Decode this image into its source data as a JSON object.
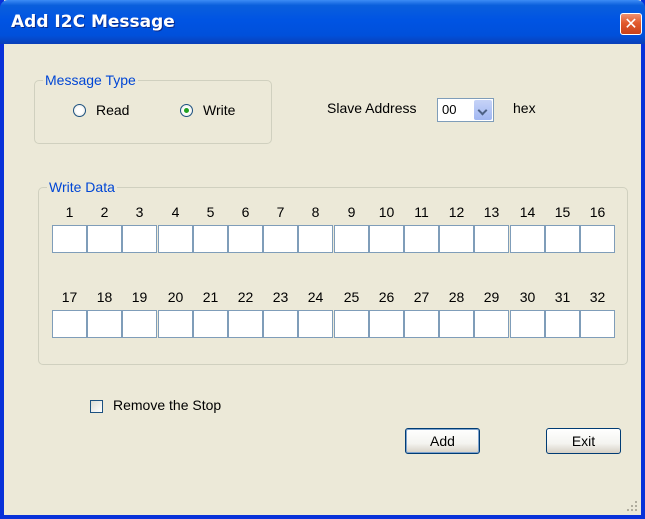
{
  "window": {
    "title": "Add I2C Message",
    "close_glyph": "✕"
  },
  "message_type": {
    "legend": "Message Type",
    "options": [
      {
        "label": "Read",
        "checked": false
      },
      {
        "label": "Write",
        "checked": true
      }
    ]
  },
  "slave_address": {
    "label": "Slave Address",
    "value": "00",
    "unit": "hex"
  },
  "write_data": {
    "legend": "Write Data",
    "row1_numbers": [
      "1",
      "2",
      "3",
      "4",
      "5",
      "6",
      "7",
      "8",
      "9",
      "10",
      "11",
      "12",
      "13",
      "14",
      "15",
      "16"
    ],
    "row2_numbers": [
      "17",
      "18",
      "19",
      "20",
      "21",
      "22",
      "23",
      "24",
      "25",
      "26",
      "27",
      "28",
      "29",
      "30",
      "31",
      "32"
    ],
    "values": [
      "",
      "",
      "",
      "",
      "",
      "",
      "",
      "",
      "",
      "",
      "",
      "",
      "",
      "",
      "",
      "",
      "",
      "",
      "",
      "",
      "",
      "",
      "",
      "",
      "",
      "",
      "",
      "",
      "",
      "",
      "",
      ""
    ]
  },
  "remove_stop": {
    "label": "Remove the Stop",
    "checked": false
  },
  "buttons": {
    "add": "Add",
    "exit": "Exit"
  },
  "colors": {
    "title_bar": "#0054e3",
    "group_legend": "#0046d5",
    "close_button": "#e25a2c",
    "dialog_face": "#ece9d8"
  },
  "icons": [
    "close-icon",
    "chevron-down-icon",
    "resize-grip-icon"
  ]
}
